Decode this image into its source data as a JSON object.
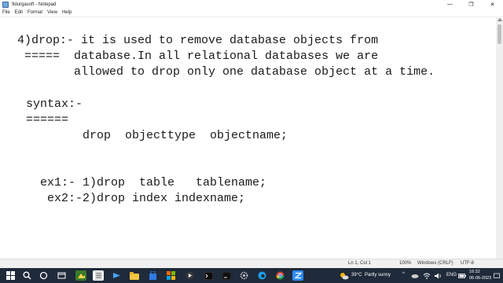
{
  "window": {
    "title": "9durgasoft - Notepad",
    "min_glyph": "—",
    "max_glyph": "❐",
    "close_glyph": "✕"
  },
  "menu": [
    "File",
    "Edit",
    "Format",
    "View",
    "Help"
  ],
  "content": {
    "lines": [
      "4)drop:- it is used to remove database objects from",
      " =====  database.In all relational databases we are",
      "        allowed to drop only one database object at a time.",
      "syntax:-",
      "======",
      "       drop  objecttype  objectname;",
      "ex1:- 1)drop  table   tablename;",
      "ex2:-2)drop index indexname;"
    ]
  },
  "statusbar": {
    "position": "Ln 1, Col 1",
    "zoom": "100%",
    "line_ending": "Windows (CRLF)",
    "encoding": "UTF-8"
  },
  "taskbar": {
    "icons": [
      "windows-start-icon",
      "search-icon",
      "task-view-icon",
      "file-explorer-icon",
      "notepad-icon",
      "browser-icon",
      "folder-icon",
      "store-icon",
      "widgets-icon",
      "media-icon",
      "terminal-icon",
      "settings-icon",
      "edge-icon",
      "chrome-icon",
      "zoom-icon"
    ],
    "weather_temp": "39°C",
    "weather_desc": "Partly sunny",
    "tray_chevron": "^",
    "language": "ENG",
    "time": "16:32",
    "date": "06-06-2023"
  },
  "colors": {
    "taskbar_bg": "#1f2a3a",
    "text": "#1a1a1a",
    "accent": "#0078d4"
  }
}
